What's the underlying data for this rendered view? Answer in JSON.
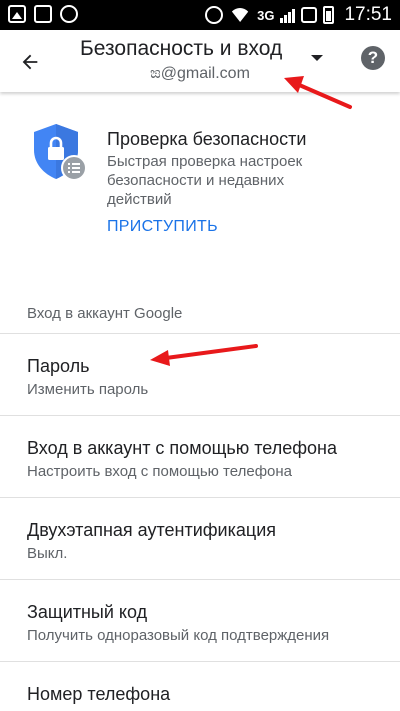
{
  "status_bar": {
    "network": "3G",
    "time": "17:51"
  },
  "toolbar": {
    "title": "Безопасность и вход",
    "account": "ಙ@gmail.com"
  },
  "checkup": {
    "title": "Проверка безопасности",
    "description": "Быстрая проверка настроек безопасности и недавних действий",
    "cta": "ПРИСТУПИТЬ"
  },
  "section": {
    "header": "Вход в аккаунт Google",
    "items": [
      {
        "title": "Пароль",
        "subtitle": "Изменить пароль"
      },
      {
        "title": "Вход в аккаунт с помощью телефона",
        "subtitle": "Настроить вход с помощью телефона"
      },
      {
        "title": "Двухэтапная аутентификация",
        "subtitle": "Выкл."
      },
      {
        "title": "Защитный код",
        "subtitle": "Получить одноразовый код подтверждения"
      },
      {
        "title": "Номер телефона",
        "subtitle": ""
      }
    ]
  },
  "colors": {
    "accent": "#1a73e8",
    "annotation": "#e8191b"
  }
}
